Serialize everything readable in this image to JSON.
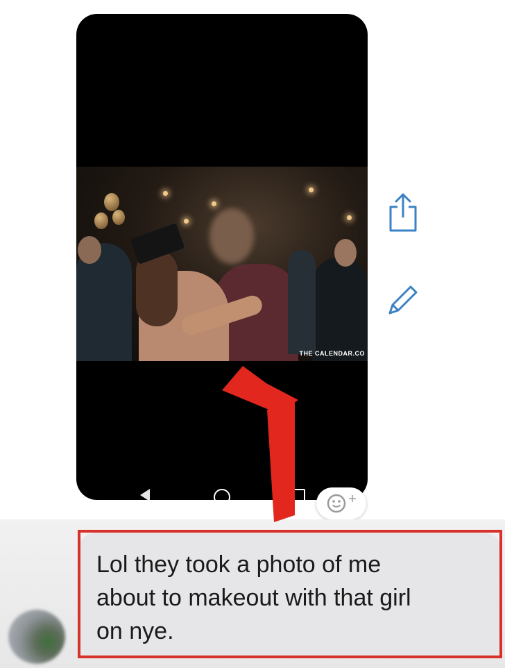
{
  "photo": {
    "watermark": "THE CALENDAR.CO"
  },
  "actions": {
    "share_icon": "share-icon",
    "edit_icon": "pencil-icon",
    "accent_color": "#3b82c4"
  },
  "reaction": {
    "icon": "smiley-add-icon",
    "plus": "+"
  },
  "message": {
    "lines": [
      "Lol they took a photo of me",
      "about to makeout with that girl",
      "on nye."
    ]
  },
  "annotation": {
    "highlight_color": "#d8302a"
  }
}
